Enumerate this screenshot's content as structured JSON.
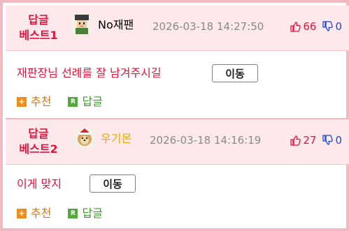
{
  "comments": [
    {
      "best_line1": "답글",
      "best_line2": "베스트1",
      "author": "No재팬",
      "author_color": "#222222",
      "avatar_icon": "pixel-character-avatar",
      "date": "2026-03-18 14:27:50",
      "upvotes": "66",
      "downvotes": "0",
      "text": "재판장님 선례를 잘 남겨주시길",
      "move_label": "이동",
      "recommend_label": "추천",
      "reply_label": "답글"
    },
    {
      "best_line1": "답글",
      "best_line2": "베스트2",
      "author": "우기몬",
      "author_color": "#e8a800",
      "avatar_icon": "dog-photo-avatar",
      "date": "2026-03-18 14:16:19",
      "upvotes": "27",
      "downvotes": "0",
      "text": "이게 맞지",
      "move_label": "이동",
      "recommend_label": "추천",
      "reply_label": "답글"
    }
  ],
  "colors": {
    "accent_red": "#e0143c",
    "down_blue": "#1e46c8",
    "header_bg": "#fde9ec",
    "border_pink": "#f4b9c0"
  }
}
